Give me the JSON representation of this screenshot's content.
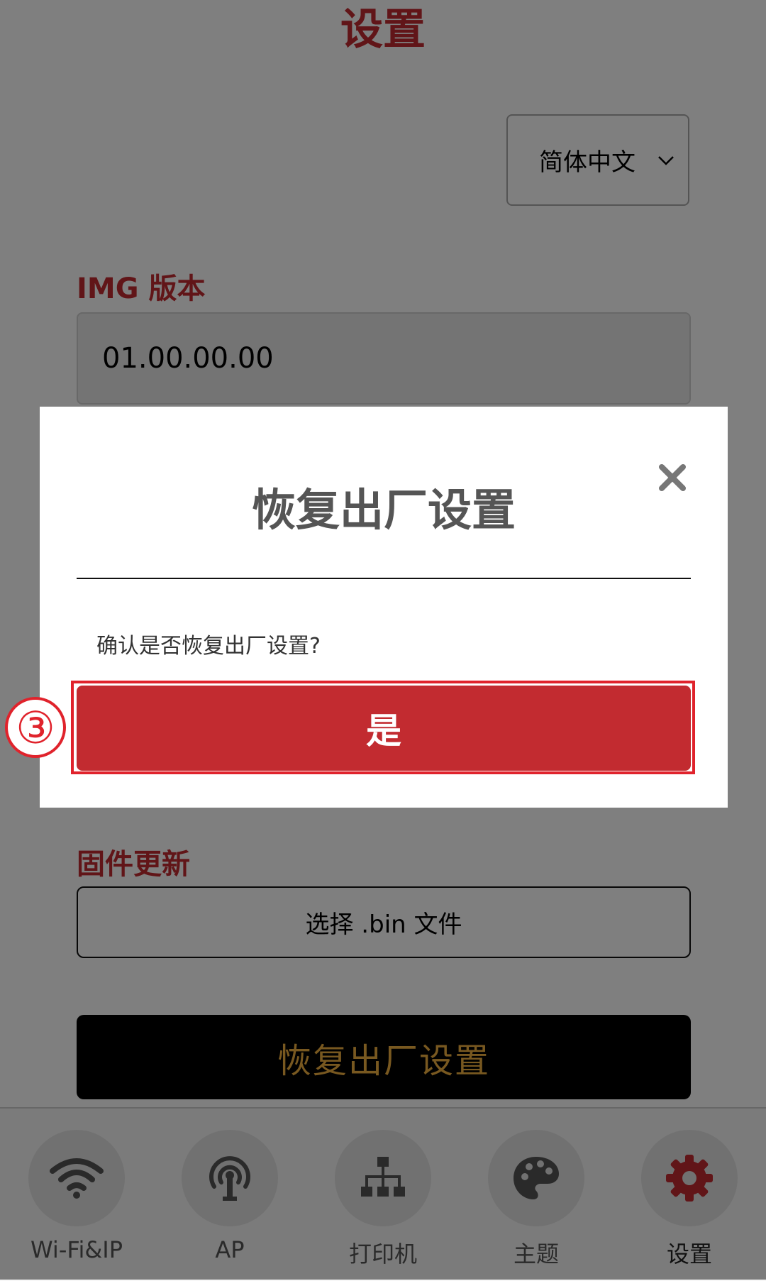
{
  "page": {
    "title": "设置"
  },
  "language": {
    "selected": "简体中文",
    "chevron_icon": "chevron-down-icon"
  },
  "img_version": {
    "label": "IMG 版本",
    "value": "01.00.00.00"
  },
  "firmware": {
    "label": "固件更新",
    "choose_file_label": "选择 .bin 文件"
  },
  "factory_reset": {
    "button_label": "恢复出厂设置"
  },
  "nav": {
    "items": [
      {
        "label": "Wi-Fi&IP",
        "icon": "wifi-icon",
        "active": false
      },
      {
        "label": "AP",
        "icon": "ap-antenna-icon",
        "active": false
      },
      {
        "label": "打印机",
        "icon": "printer-network-icon",
        "active": false
      },
      {
        "label": "主题",
        "icon": "palette-icon",
        "active": false
      },
      {
        "label": "设置",
        "icon": "gear-icon",
        "active": true
      }
    ]
  },
  "modal": {
    "title": "恢复出厂设置",
    "message": "确认是否恢复出厂设置?",
    "confirm_label": "是",
    "close_icon": "close-icon"
  },
  "annotation": {
    "step_marker": "③"
  },
  "colors": {
    "brand_red": "#c22b30",
    "highlight_red": "#e0232c",
    "reset_text": "#f0b140",
    "overlay": "rgba(0,0,0,0.5)"
  }
}
